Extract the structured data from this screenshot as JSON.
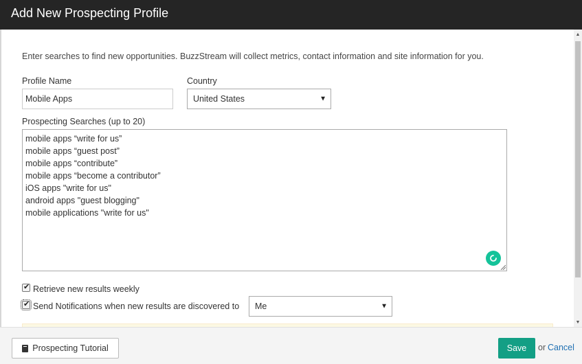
{
  "header": {
    "title": "Add New Prospecting Profile"
  },
  "intro": "Enter searches to find new opportunities. BuzzStream will collect metrics, contact information and site information for you.",
  "profile": {
    "label": "Profile Name",
    "value": "Mobile Apps"
  },
  "country": {
    "label": "Country",
    "value": "United States"
  },
  "searches": {
    "label": "Prospecting Searches (up to 20)",
    "lines": [
      "mobile apps “write for us”",
      "mobile apps “guest post”",
      "mobile apps “contribute”",
      "mobile apps “become a contributor”",
      "iOS apps \"write for us\"",
      "android apps \"guest blogging\"",
      "mobile applications \"write for us\""
    ]
  },
  "options": {
    "weekly": {
      "label": "Retrieve new results weekly",
      "checked": true
    },
    "notify": {
      "label": "Send Notifications when new results are discovered to",
      "checked": true,
      "recipient": "Me"
    }
  },
  "footer": {
    "tutorial_label": "Prospecting Tutorial",
    "save_label": "Save",
    "or_text": "or",
    "cancel_label": "Cancel"
  },
  "icons": {
    "tutorial": "book-icon",
    "grammar": "grammarly-icon",
    "dropdown": "chevron-down-icon"
  },
  "colors": {
    "header_bg": "#252525",
    "save_bg": "#139f85",
    "cancel_link": "#1f6fb2",
    "grammar_badge": "#15c39a"
  }
}
